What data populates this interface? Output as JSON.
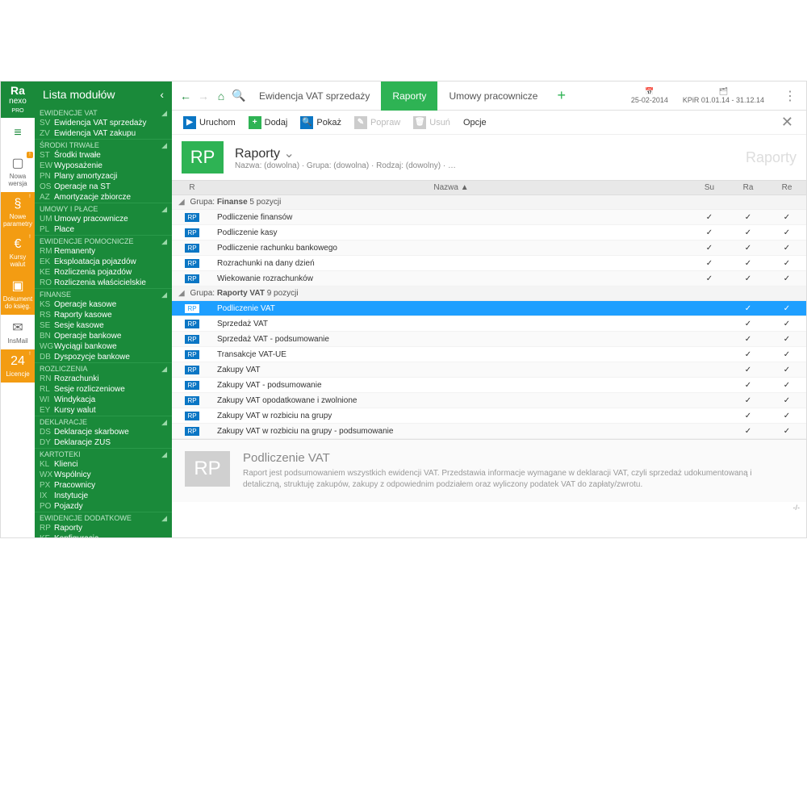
{
  "logo": {
    "top": "Ra",
    "mid": "nexo",
    "bot": "PRO"
  },
  "rail": [
    {
      "icon": "≡",
      "label": "",
      "cls": "rail-hamburger"
    },
    {
      "icon": "▢",
      "label": "Nowa wersja",
      "badge": "1"
    },
    {
      "icon": "§",
      "label": "Nowe parametry",
      "badge": "1",
      "cls": "orange"
    },
    {
      "icon": "€",
      "label": "Kursy walut",
      "badge": "1",
      "cls": "orange"
    },
    {
      "icon": "▣",
      "label": "Dokument do księg.",
      "cls": "orange"
    },
    {
      "icon": "✉",
      "label": "InsMail"
    },
    {
      "icon": "24",
      "label": "Licencje",
      "badge": "1",
      "cls": "orange"
    }
  ],
  "sidebar": {
    "title": "Lista modułów",
    "sections": [
      {
        "h": "EWIDENCJE VAT",
        "items": [
          [
            "SV",
            "Ewidencja VAT sprzedaży"
          ],
          [
            "ZV",
            "Ewidencja VAT zakupu"
          ]
        ]
      },
      {
        "h": "ŚRODKI TRWAŁE",
        "items": [
          [
            "ST",
            "Środki trwałe"
          ],
          [
            "EW",
            "Wyposażenie"
          ],
          [
            "PN",
            "Plany amortyzacji"
          ],
          [
            "OS",
            "Operacje na ST"
          ],
          [
            "AZ",
            "Amortyzacje zbiorcze"
          ]
        ]
      },
      {
        "h": "UMOWY I PŁACE",
        "items": [
          [
            "UM",
            "Umowy pracownicze"
          ],
          [
            "PL",
            "Płace"
          ]
        ]
      },
      {
        "h": "EWIDENCJE POMOCNICZE",
        "items": [
          [
            "RM",
            "Remanenty"
          ],
          [
            "EK",
            "Eksploatacja pojazdów"
          ],
          [
            "KE",
            "Rozliczenia pojazdów"
          ],
          [
            "RO",
            "Rozliczenia właścicielskie"
          ]
        ]
      },
      {
        "h": "FINANSE",
        "items": [
          [
            "KS",
            "Operacje kasowe"
          ],
          [
            "RS",
            "Raporty kasowe"
          ],
          [
            "SE",
            "Sesje kasowe"
          ],
          [
            "BN",
            "Operacje bankowe"
          ],
          [
            "WG",
            "Wyciągi bankowe"
          ],
          [
            "DB",
            "Dyspozycje bankowe"
          ]
        ]
      },
      {
        "h": "ROZLICZENIA",
        "items": [
          [
            "RN",
            "Rozrachunki"
          ],
          [
            "RL",
            "Sesje rozliczeniowe"
          ],
          [
            "WI",
            "Windykacja"
          ],
          [
            "EY",
            "Kursy walut"
          ]
        ]
      },
      {
        "h": "DEKLARACJE",
        "items": [
          [
            "DS",
            "Deklaracje skarbowe"
          ],
          [
            "DY",
            "Deklaracje ZUS"
          ]
        ]
      },
      {
        "h": "KARTOTEKI",
        "items": [
          [
            "KL",
            "Klienci"
          ],
          [
            "WX",
            "Wspólnicy"
          ],
          [
            "PX",
            "Pracownicy"
          ],
          [
            "IX",
            "Instytucje"
          ],
          [
            "PO",
            "Pojazdy"
          ]
        ]
      },
      {
        "h": "EWIDENCJE DODATKOWE",
        "items": [
          [
            "RP",
            "Raporty"
          ],
          [
            "KF",
            "Konfiguracja"
          ]
        ]
      }
    ]
  },
  "tabs": {
    "items": [
      "Ewidencja VAT sprzedaży",
      "Raporty",
      "Umowy pracownicze"
    ],
    "active": 1,
    "date": "25-02-2014",
    "period": "KPiR  01.01.14 - 31.12.14"
  },
  "toolbar": {
    "run": "Uruchom",
    "add": "Dodaj",
    "show": "Pokaż",
    "edit": "Popraw",
    "del": "Usuń",
    "opt": "Opcje"
  },
  "header": {
    "badge": "RP",
    "title": "Raporty",
    "sub": "Nazwa: (dowolna) · Grupa: (dowolna) · Rodzaj: (dowolny) · …",
    "right": "Raporty"
  },
  "columns": {
    "r": "R",
    "name": "Nazwa ▲",
    "su": "Su",
    "ra": "Ra",
    "re": "Re"
  },
  "groups": [
    {
      "label": "Finanse",
      "count": "5 pozycji",
      "rows": [
        {
          "n": "Podliczenie finansów",
          "su": true,
          "ra": true,
          "re": true
        },
        {
          "n": "Podliczenie kasy",
          "su": true,
          "ra": true,
          "re": true
        },
        {
          "n": "Podliczenie rachunku bankowego",
          "su": true,
          "ra": true,
          "re": true
        },
        {
          "n": "Rozrachunki na dany dzień",
          "su": true,
          "ra": true,
          "re": true
        },
        {
          "n": "Wiekowanie rozrachunków",
          "su": true,
          "ra": true,
          "re": true
        }
      ]
    },
    {
      "label": "Raporty VAT",
      "count": "9 pozycji",
      "rows": [
        {
          "n": "Podliczenie VAT",
          "su": false,
          "ra": true,
          "re": true,
          "selected": true
        },
        {
          "n": "Sprzedaż VAT",
          "su": false,
          "ra": true,
          "re": true
        },
        {
          "n": "Sprzedaż VAT - podsumowanie",
          "su": false,
          "ra": true,
          "re": true
        },
        {
          "n": "Transakcje VAT-UE",
          "su": false,
          "ra": true,
          "re": true
        },
        {
          "n": "Zakupy VAT",
          "su": false,
          "ra": true,
          "re": true
        },
        {
          "n": "Zakupy VAT - podsumowanie",
          "su": false,
          "ra": true,
          "re": true
        },
        {
          "n": "Zakupy VAT opodatkowane i zwolnione",
          "su": false,
          "ra": true,
          "re": true
        },
        {
          "n": "Zakupy VAT w rozbiciu na grupy",
          "su": false,
          "ra": true,
          "re": true
        },
        {
          "n": "Zakupy VAT w rozbiciu na grupy - podsumowanie",
          "su": false,
          "ra": true,
          "re": true
        }
      ]
    }
  ],
  "detail": {
    "badge": "RP",
    "title": "Podliczenie VAT",
    "desc": "Raport jest podsumowaniem wszystkich ewidencji VAT. Przedstawia informacje wymagane w deklaracji VAT, czyli sprzedaż udokumentowaną i detaliczną, struktuję zakupów, zakupy z odpowiednim podziałem oraz wyliczony podatek VAT do zapłaty/zwrotu."
  },
  "footer": "-/-"
}
